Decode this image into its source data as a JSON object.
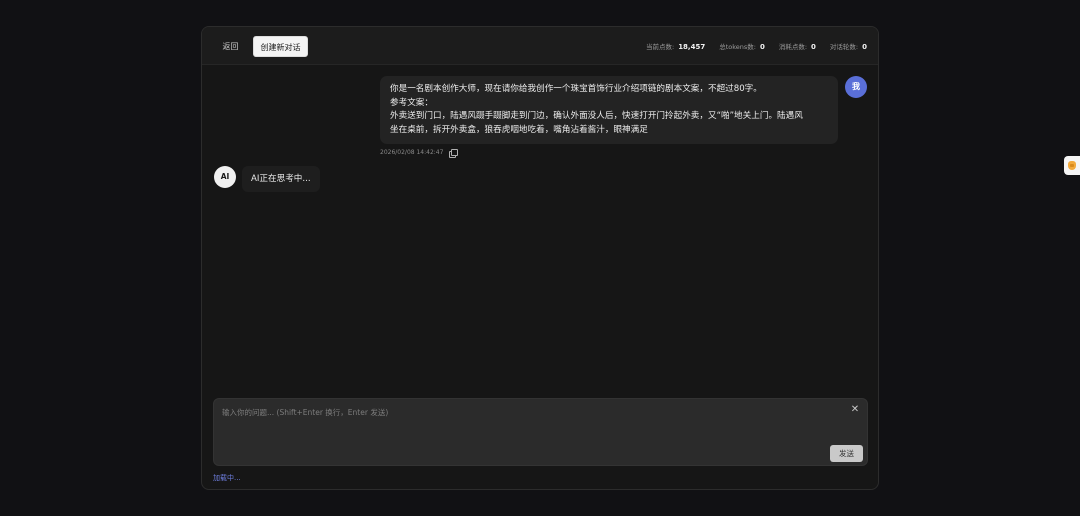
{
  "topbar": {
    "back_label": "返回",
    "new_chat_label": "创建新对话",
    "stats": [
      {
        "label": "当前点数:",
        "value": "18,457"
      },
      {
        "label": "总tokens数:",
        "value": "0"
      },
      {
        "label": "消耗点数:",
        "value": "0"
      },
      {
        "label": "对话轮数:",
        "value": "0"
      }
    ]
  },
  "messages": {
    "user": {
      "avatar": "我",
      "lines": [
        "你是一名剧本创作大师，现在请你给我创作一个珠宝首饰行业介绍项链的剧本文案，不超过80字。",
        "参考文案：",
        "外卖送到门口，陆遇风蹑手蹑脚走到门边，确认外面没人后，快速打开门拎起外卖，又“啪”地关上门。陆遇风",
        "坐在桌前，拆开外卖盒，狼吞虎咽地吃着，嘴角沾着酱汁，眼神满足"
      ],
      "timestamp": "2026/02/08 14:42:47"
    },
    "ai": {
      "avatar": "AI",
      "text": "AI正在思考中..."
    }
  },
  "composer": {
    "placeholder": "输入你的问题... (Shift+Enter 换行，Enter 发送)",
    "value": "",
    "send_label": "发送"
  },
  "status": {
    "loading": "加载中..."
  },
  "colors": {
    "accent": "#5a6fd8",
    "background": "#111114",
    "panel": "#161616"
  }
}
